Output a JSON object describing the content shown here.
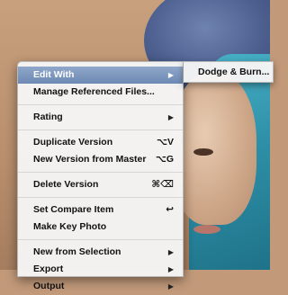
{
  "menu": {
    "items": [
      {
        "label": "Edit With",
        "shortcut": "",
        "submenu": true,
        "selected": true
      },
      {
        "label": "Manage Referenced Files...",
        "shortcut": "",
        "submenu": false
      },
      {
        "label": "Rating",
        "shortcut": "",
        "submenu": true
      },
      {
        "label": "Duplicate Version",
        "shortcut": "⌥V",
        "submenu": false
      },
      {
        "label": "New Version from Master",
        "shortcut": "⌥G",
        "submenu": false
      },
      {
        "label": "Delete Version",
        "shortcut": "⌘⌫",
        "submenu": false
      },
      {
        "label": "Set Compare Item",
        "shortcut": "↩",
        "submenu": false
      },
      {
        "label": "Make Key Photo",
        "shortcut": "",
        "submenu": false
      },
      {
        "label": "New from Selection",
        "shortcut": "",
        "submenu": true
      },
      {
        "label": "Export",
        "shortcut": "",
        "submenu": true
      },
      {
        "label": "Output",
        "shortcut": "",
        "submenu": true
      }
    ],
    "submenu_arrow": "▶"
  },
  "submenu": {
    "items": [
      {
        "label": "Dodge & Burn..."
      }
    ]
  }
}
